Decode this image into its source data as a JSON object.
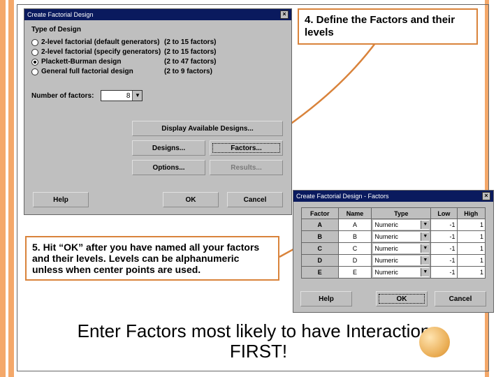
{
  "dlg1": {
    "title": "Create Factorial Design",
    "group": "Type of Design",
    "options": [
      {
        "label": "2-level factorial (default generators)",
        "count": "(2 to 15 factors)",
        "sel": false
      },
      {
        "label": "2-level factorial (specify generators)",
        "count": "(2 to 15 factors)",
        "sel": false
      },
      {
        "label": "Plackett-Burman design",
        "count": "(2 to 47 factors)",
        "sel": true
      },
      {
        "label": "General full factorial design",
        "count": "(2 to 9 factors)",
        "sel": false
      }
    ],
    "nf_label": "Number of factors:",
    "nf_value": "8",
    "btn_display": "Display Available Designs...",
    "btn_designs": "Designs...",
    "btn_factors": "Factors...",
    "btn_options": "Options...",
    "btn_results": "Results...",
    "btn_help": "Help",
    "btn_ok": "OK",
    "btn_cancel": "Cancel"
  },
  "dlg2": {
    "title": "Create Factorial Design - Factors",
    "headers": [
      "Factor",
      "Name",
      "Type",
      "Low",
      "High"
    ],
    "rows": [
      {
        "f": "A",
        "n": "A",
        "t": "Numeric",
        "l": "-1",
        "h": "1"
      },
      {
        "f": "B",
        "n": "B",
        "t": "Numeric",
        "l": "-1",
        "h": "1"
      },
      {
        "f": "C",
        "n": "C",
        "t": "Numeric",
        "l": "-1",
        "h": "1"
      },
      {
        "f": "D",
        "n": "D",
        "t": "Numeric",
        "l": "-1",
        "h": "1"
      },
      {
        "f": "E",
        "n": "E",
        "t": "Numeric",
        "l": "-1",
        "h": "1"
      }
    ],
    "btn_help": "Help",
    "btn_ok": "OK",
    "btn_cancel": "Cancel"
  },
  "callout4": "4.  Define the Factors and their levels",
  "callout5": "5. Hit “OK” after you have named all your factors and their levels.  Levels can be alphanumeric unless when center points are used.",
  "bigmsg": "Enter Factors most likely to have Interactions FIRST!"
}
